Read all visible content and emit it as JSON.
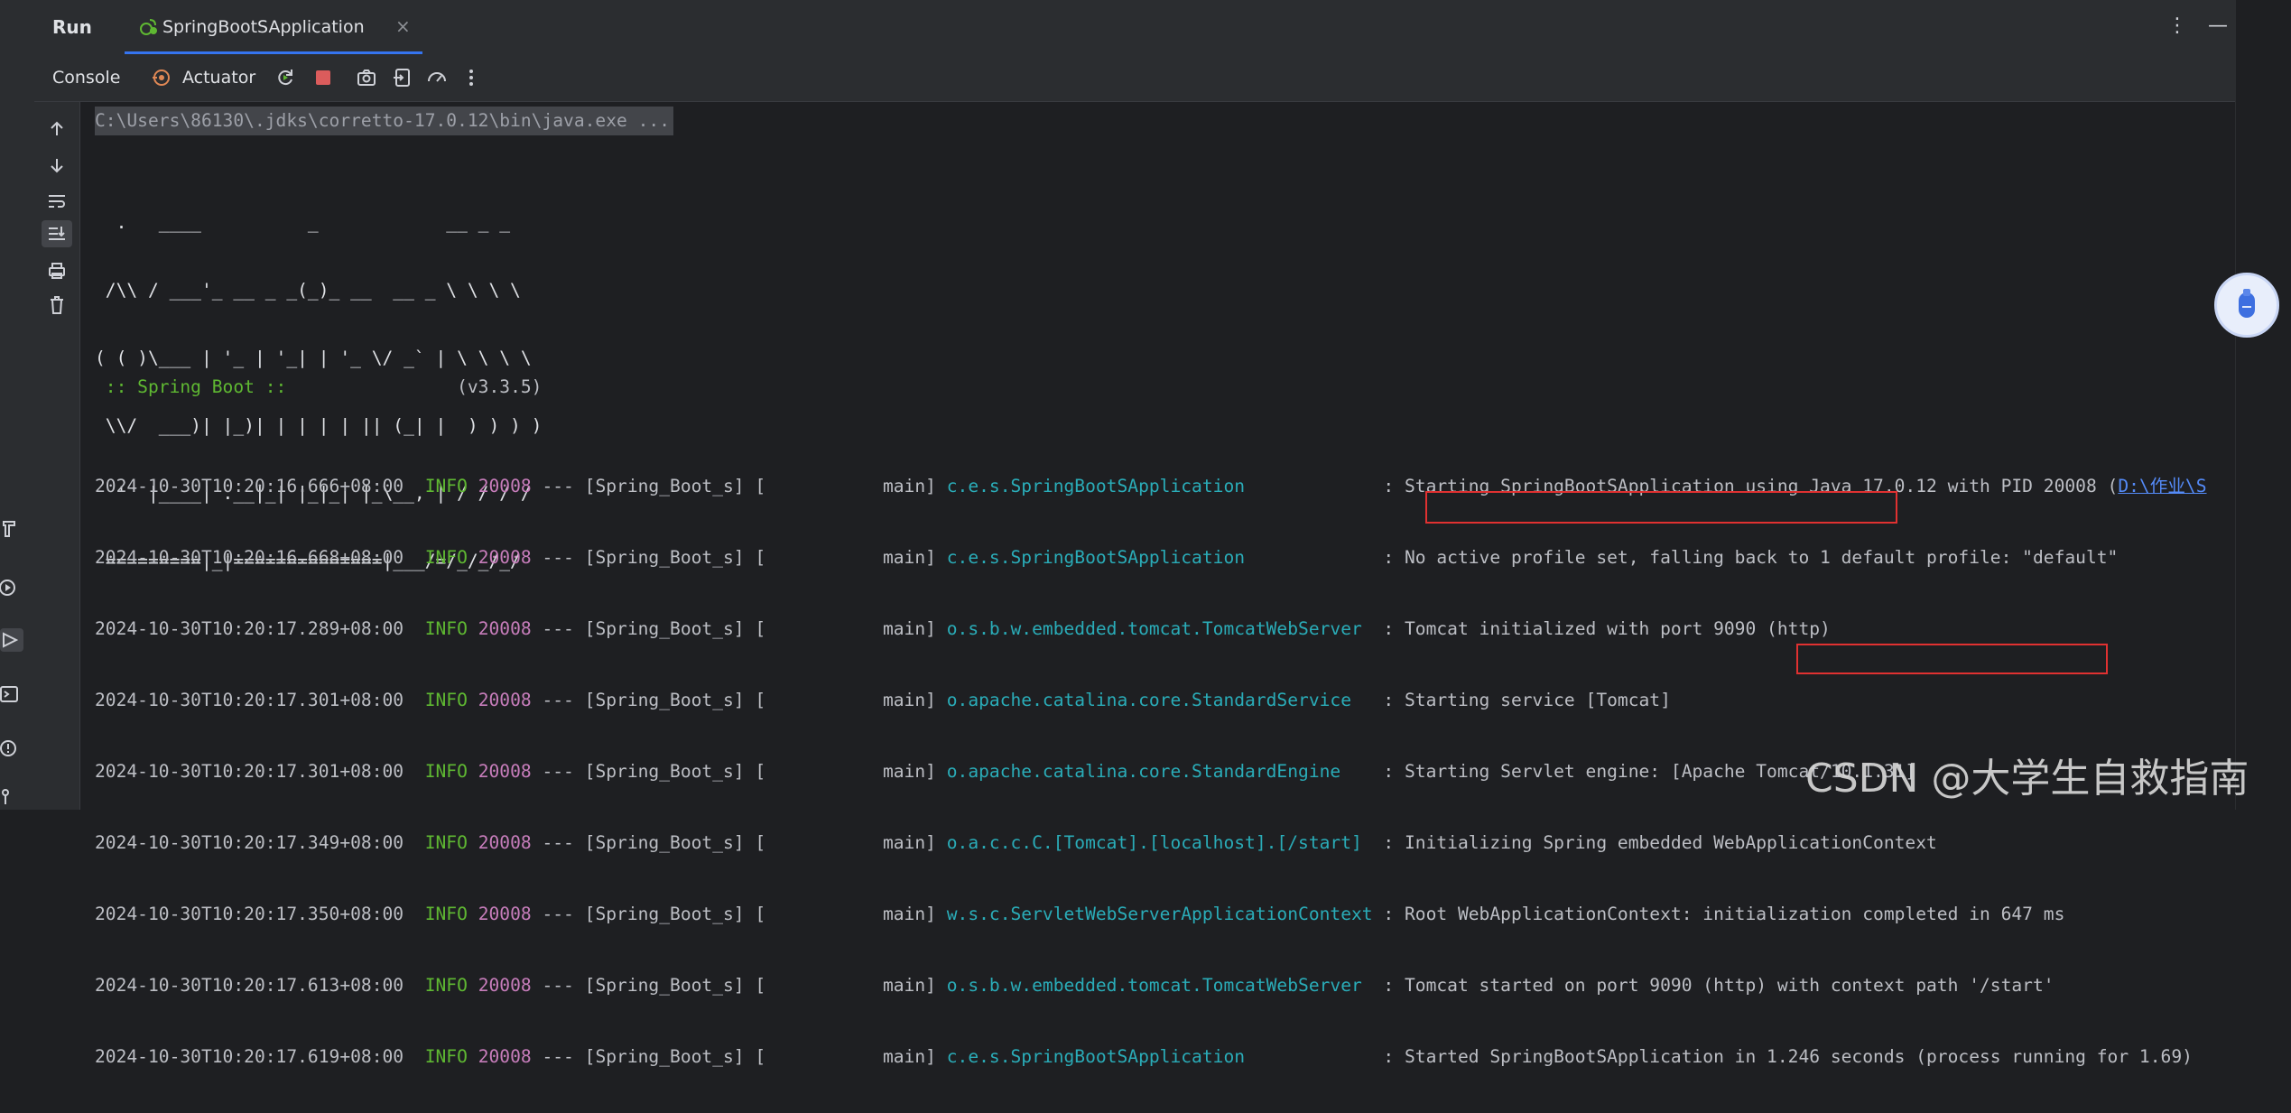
{
  "header": {
    "run_label": "Run",
    "tab_title": "SpringBootSApplication",
    "tab_close": "×",
    "more_menu": "⋮",
    "minimize": "—"
  },
  "toolbar": {
    "console_label": "Console",
    "actuator_label": "Actuator",
    "icons": [
      "actuator-icon",
      "rerun-icon",
      "stop-icon",
      "screenshot-icon",
      "exit-icon",
      "speedometer-icon",
      "more-options-icon"
    ]
  },
  "gutter": {
    "icons": [
      "arrow-up-icon",
      "arrow-down-icon",
      "soft-wrap-icon",
      "scroll-to-end-icon",
      "print-icon",
      "trash-icon"
    ]
  },
  "console": {
    "command": "C:\\Users\\86130\\.jdks\\corretto-17.0.12\\bin\\java.exe ...",
    "banner": [
      "  .   ____          _            __ _ _",
      " /\\\\ / ___'_ __ _ _(_)_ __  __ _ \\ \\ \\ \\",
      "( ( )\\___ | '_ | '_| | '_ \\/ _` | \\ \\ \\ \\",
      " \\\\/  ___)| |_)| | | | | || (_| |  ) ) ) )",
      "  '  |____| .__|_| |_|_| |_\\__, | / / / /",
      " =========|_|==============|___/=/_/_/_/"
    ],
    "spring_label": " :: Spring Boot :: ",
    "spring_version": "               (v3.3.5)",
    "log": [
      {
        "ts": "2024-10-30T10:20:16.666+08:00",
        "level": "INFO",
        "pid": "20008",
        "mid": " --- [Spring_Boot_s] [           main] ",
        "logger": "c.e.s.SpringBootSApplication            ",
        "msg": " : Starting SpringBootSApplication using Java 17.0.12 with PID 20008 (",
        "link": "D:\\作业\\S"
      },
      {
        "ts": "2024-10-30T10:20:16.668+08:00",
        "level": "INFO",
        "pid": "20008",
        "mid": " --- [Spring_Boot_s] [           main] ",
        "logger": "c.e.s.SpringBootSApplication            ",
        "msg": " : No active profile set, falling back to 1 default profile: \"default\""
      },
      {
        "ts": "2024-10-30T10:20:17.289+08:00",
        "level": "INFO",
        "pid": "20008",
        "mid": " --- [Spring_Boot_s] [           main] ",
        "logger": "o.s.b.w.embedded.tomcat.TomcatWebServer ",
        "msg": " : Tomcat initialized with port 9090 (http)"
      },
      {
        "ts": "2024-10-30T10:20:17.301+08:00",
        "level": "INFO",
        "pid": "20008",
        "mid": " --- [Spring_Boot_s] [           main] ",
        "logger": "o.apache.catalina.core.StandardService  ",
        "msg": " : Starting service [Tomcat]"
      },
      {
        "ts": "2024-10-30T10:20:17.301+08:00",
        "level": "INFO",
        "pid": "20008",
        "mid": " --- [Spring_Boot_s] [           main] ",
        "logger": "o.apache.catalina.core.StandardEngine   ",
        "msg": " : Starting Servlet engine: [Apache Tomcat/10.1.31]"
      },
      {
        "ts": "2024-10-30T10:20:17.349+08:00",
        "level": "INFO",
        "pid": "20008",
        "mid": " --- [Spring_Boot_s] [           main] ",
        "logger": "o.a.c.c.C.[Tomcat].[localhost].[/start] ",
        "msg": " : Initializing Spring embedded WebApplicationContext"
      },
      {
        "ts": "2024-10-30T10:20:17.350+08:00",
        "level": "INFO",
        "pid": "20008",
        "mid": " --- [Spring_Boot_s] [           main] ",
        "logger": "w.s.c.ServletWebServerApplicationContext",
        "msg": " : Root WebApplicationContext: initialization completed in 647 ms"
      },
      {
        "ts": "2024-10-30T10:20:17.613+08:00",
        "level": "INFO",
        "pid": "20008",
        "mid": " --- [Spring_Boot_s] [           main] ",
        "logger": "o.s.b.w.embedded.tomcat.TomcatWebServer ",
        "msg": " : Tomcat started on port 9090 (http) with context path '/start'"
      },
      {
        "ts": "2024-10-30T10:20:17.619+08:00",
        "level": "INFO",
        "pid": "20008",
        "mid": " --- [Spring_Boot_s] [           main] ",
        "logger": "c.e.s.SpringBootSApplication            ",
        "msg": " : Started SpringBootSApplication in 1.246 seconds (process running for 1.69)"
      }
    ]
  },
  "watermark": "CSDN @大学生自救指南",
  "colors": {
    "background": "#1e1f22",
    "panel": "#2b2d30",
    "info_green": "#5fb832",
    "pid_purple": "#c77dbb",
    "logger_teal": "#2aacb8",
    "accent_blue": "#3574f0",
    "highlight_red": "#e03131"
  }
}
